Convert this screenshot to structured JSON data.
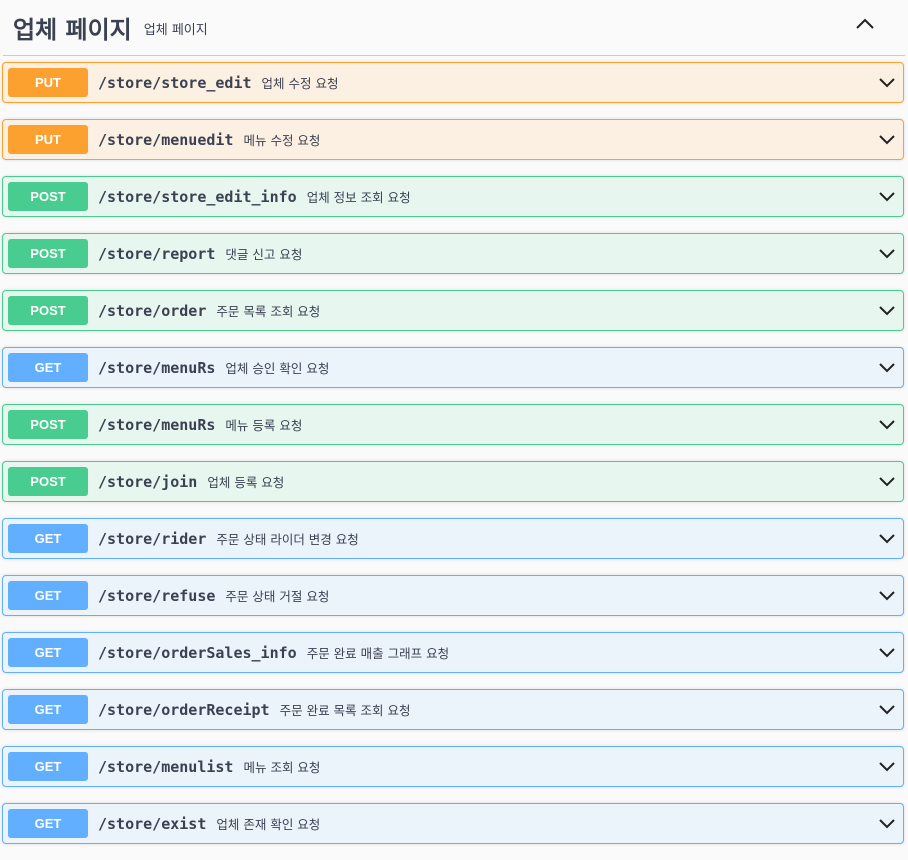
{
  "tag": {
    "title": "업체 페이지",
    "description": "업체 페이지"
  },
  "colors": {
    "PUT": "#fca130",
    "POST": "#49cc90",
    "GET": "#61affe"
  },
  "backgrounds": {
    "PUT": "#fcf0e3",
    "POST": "#e8f6f0",
    "GET": "#ebf3fb"
  },
  "operations": [
    {
      "method": "PUT",
      "path": "/store/store_edit",
      "summary": "업체 수정 요청"
    },
    {
      "method": "PUT",
      "path": "/store/menuedit",
      "summary": "메뉴 수정 요청"
    },
    {
      "method": "POST",
      "path": "/store/store_edit_info",
      "summary": "업체 정보 조회 요청"
    },
    {
      "method": "POST",
      "path": "/store/report",
      "summary": "댓글 신고 요청"
    },
    {
      "method": "POST",
      "path": "/store/order",
      "summary": "주문 목록 조회 요청"
    },
    {
      "method": "GET",
      "path": "/store/menuRs",
      "summary": "업체 승인 확인 요청"
    },
    {
      "method": "POST",
      "path": "/store/menuRs",
      "summary": "메뉴 등록 요청"
    },
    {
      "method": "POST",
      "path": "/store/join",
      "summary": "업체 등록 요청"
    },
    {
      "method": "GET",
      "path": "/store/rider",
      "summary": "주문 상태 라이더 변경 요청"
    },
    {
      "method": "GET",
      "path": "/store/refuse",
      "summary": "주문 상태 거절 요청"
    },
    {
      "method": "GET",
      "path": "/store/orderSales_info",
      "summary": "주문 완료 매출 그래프 요청"
    },
    {
      "method": "GET",
      "path": "/store/orderReceipt",
      "summary": "주문 완료 목록 조회 요청"
    },
    {
      "method": "GET",
      "path": "/store/menulist",
      "summary": "메뉴 조회 요청"
    },
    {
      "method": "GET",
      "path": "/store/exist",
      "summary": "업체 존재 확인 요청"
    }
  ]
}
